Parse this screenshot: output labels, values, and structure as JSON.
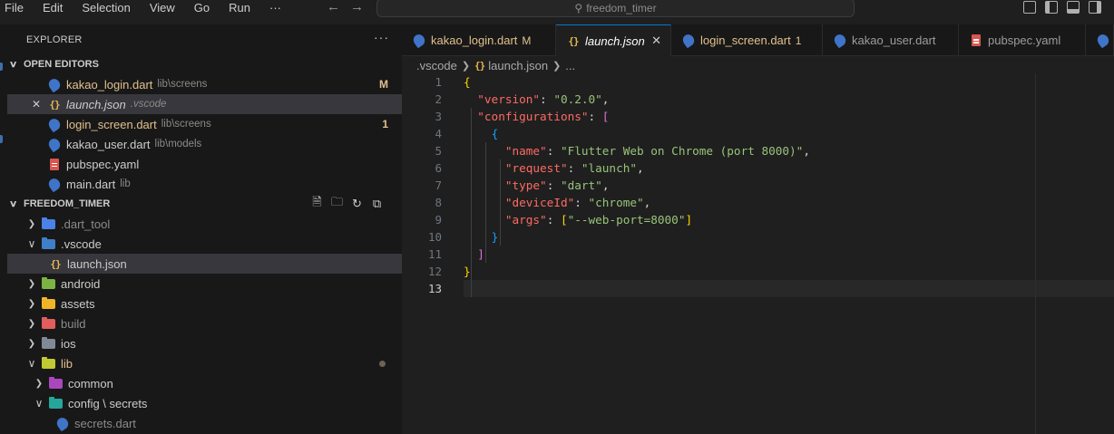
{
  "menu": [
    "File",
    "Edit",
    "Selection",
    "View",
    "Go",
    "Run",
    "···"
  ],
  "search": {
    "text": "freedom_timer"
  },
  "explorer": {
    "title": "EXPLORER",
    "more": "···",
    "open_editors": {
      "title": "OPEN EDITORS",
      "items": [
        {
          "name": "kakao_login.dart",
          "desc": "lib\\screens",
          "badge": "M",
          "color": "#e2c08d",
          "icon": "dart-icon"
        },
        {
          "name": "launch.json",
          "desc": ".vscode",
          "badge": "",
          "color": "#cccccc",
          "icon": "json-icon",
          "selected": true,
          "italic": true
        },
        {
          "name": "login_screen.dart",
          "desc": "lib\\screens",
          "badge": "1",
          "color": "#e2c08d",
          "icon": "dart-icon"
        },
        {
          "name": "kakao_user.dart",
          "desc": "lib\\models",
          "badge": "",
          "color": "#cccccc",
          "icon": "dart-icon"
        },
        {
          "name": "pubspec.yaml",
          "desc": "",
          "badge": "",
          "color": "#cccccc",
          "icon": "yaml-icon"
        },
        {
          "name": "main.dart",
          "desc": "lib",
          "badge": "",
          "color": "#cccccc",
          "icon": "dart-icon"
        }
      ]
    },
    "folder": {
      "title": "FREEDOM_TIMER",
      "items": [
        {
          "name": ".dart_tool",
          "type": "folder",
          "open": false,
          "color": "#4b82e6",
          "text_color": "#8b8b8b"
        },
        {
          "name": ".vscode",
          "type": "folder",
          "open": true,
          "color": "#3e7fc8",
          "text_color": "#cccccc"
        },
        {
          "name": "launch.json",
          "type": "file",
          "icon": "json-icon",
          "text_color": "#cccccc",
          "selected": true
        },
        {
          "name": "android",
          "type": "folder",
          "open": false,
          "color": "#7cb342",
          "text_color": "#cccccc"
        },
        {
          "name": "assets",
          "type": "folder",
          "open": false,
          "color": "#f0b429",
          "text_color": "#cccccc"
        },
        {
          "name": "build",
          "type": "folder",
          "open": false,
          "color": "#e25d5d",
          "text_color": "#8b8b8b"
        },
        {
          "name": "ios",
          "type": "folder",
          "open": false,
          "color": "#7f8a96",
          "text_color": "#cccccc"
        },
        {
          "name": "lib",
          "type": "folder",
          "open": true,
          "color": "#c0ca33",
          "text_color": "#e2c08d",
          "dot": true
        },
        {
          "name": "common",
          "type": "folder",
          "open": false,
          "color": "#ab47bc",
          "text_color": "#cccccc"
        },
        {
          "name": "config \\ secrets",
          "type": "folder",
          "open": true,
          "color": "#26a69a",
          "text_color": "#cccccc"
        },
        {
          "name": "secrets.dart",
          "type": "file",
          "icon": "dart-icon",
          "text_color": "#8b8b8b"
        }
      ]
    }
  },
  "tabs": [
    {
      "name": "kakao_login.dart",
      "mark": "M",
      "color": "#e2c08d",
      "icon": "dart-icon",
      "width": 170
    },
    {
      "name": "launch.json",
      "mark": "",
      "color": "#ffffff",
      "icon": "json-icon",
      "active": true,
      "italic": true,
      "width": 127
    },
    {
      "name": "login_screen.dart",
      "mark": "1",
      "color": "#e2c08d",
      "icon": "dart-icon",
      "width": 167
    },
    {
      "name": "kakao_user.dart",
      "mark": "",
      "color": "#9d9d9d",
      "icon": "dart-icon",
      "width": 150
    },
    {
      "name": "pubspec.yaml",
      "mark": "",
      "color": "#9d9d9d",
      "icon": "yaml-icon",
      "width": 140
    },
    {
      "name": "",
      "mark": "",
      "color": "#9d9d9d",
      "icon": "dart-icon",
      "width": 31
    }
  ],
  "breadcrumb": [
    ".vscode",
    "launch.json",
    "..."
  ],
  "code": {
    "lines": [
      [
        [
          "{",
          "b1"
        ]
      ],
      [
        [
          "  ",
          ""
        ],
        [
          "\"version\"",
          "key"
        ],
        [
          ": ",
          "pun"
        ],
        [
          "\"0.2.0\"",
          "str"
        ],
        [
          ",",
          "pun"
        ]
      ],
      [
        [
          "  ",
          ""
        ],
        [
          "\"configurations\"",
          "key"
        ],
        [
          ": ",
          "pun"
        ],
        [
          "[",
          "b2"
        ]
      ],
      [
        [
          "    ",
          ""
        ],
        [
          "{",
          "b3"
        ]
      ],
      [
        [
          "      ",
          ""
        ],
        [
          "\"name\"",
          "key"
        ],
        [
          ": ",
          "pun"
        ],
        [
          "\"Flutter Web on Chrome (port 8000)\"",
          "str"
        ],
        [
          ",",
          "pun"
        ]
      ],
      [
        [
          "      ",
          ""
        ],
        [
          "\"request\"",
          "key"
        ],
        [
          ": ",
          "pun"
        ],
        [
          "\"launch\"",
          "str"
        ],
        [
          ",",
          "pun"
        ]
      ],
      [
        [
          "      ",
          ""
        ],
        [
          "\"type\"",
          "key"
        ],
        [
          ": ",
          "pun"
        ],
        [
          "\"dart\"",
          "str"
        ],
        [
          ",",
          "pun"
        ]
      ],
      [
        [
          "      ",
          ""
        ],
        [
          "\"deviceId\"",
          "key"
        ],
        [
          ": ",
          "pun"
        ],
        [
          "\"chrome\"",
          "str"
        ],
        [
          ",",
          "pun"
        ]
      ],
      [
        [
          "      ",
          ""
        ],
        [
          "\"args\"",
          "key"
        ],
        [
          ": ",
          "pun"
        ],
        [
          "[",
          "b1"
        ],
        [
          "\"--web-port=8000\"",
          "str"
        ],
        [
          "]",
          "b1"
        ]
      ],
      [
        [
          "    ",
          ""
        ],
        [
          "}",
          "b3"
        ]
      ],
      [
        [
          "  ",
          ""
        ],
        [
          "]",
          "b2"
        ]
      ],
      [
        [
          "}",
          "b1"
        ]
      ],
      [
        [
          "",
          ""
        ]
      ]
    ],
    "active_line": 13
  }
}
